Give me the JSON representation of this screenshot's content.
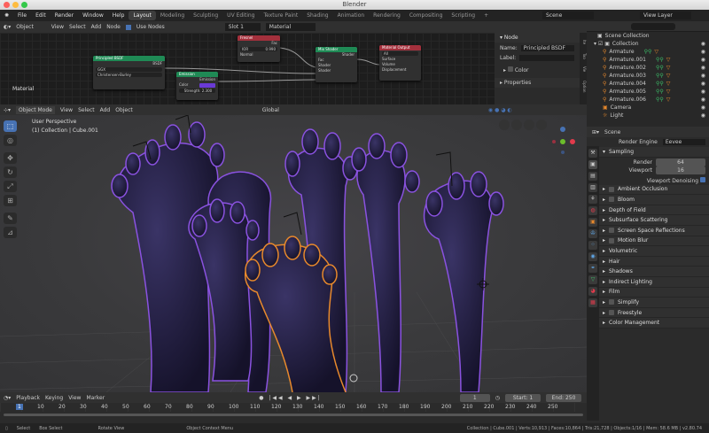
{
  "window": {
    "title": "Blender"
  },
  "topbar": {
    "menus": [
      "File",
      "Edit",
      "Render",
      "Window",
      "Help"
    ],
    "workspaces": [
      "Layout",
      "Modeling",
      "Sculpting",
      "UV Editing",
      "Texture Paint",
      "Shading",
      "Animation",
      "Rendering",
      "Compositing",
      "Scripting"
    ],
    "active_workspace": "Layout",
    "add": "+",
    "scene": "Scene",
    "view_layer": "View Layer"
  },
  "node_header": {
    "mode": "Object",
    "menus": [
      "View",
      "Select",
      "Add",
      "Node"
    ],
    "use_nodes": "Use Nodes",
    "slot": "Slot 1",
    "material": "Material",
    "label": "Material"
  },
  "nodes": {
    "principled": {
      "title": "Principled BSDF",
      "out": "BSDF",
      "dist": "GGX",
      "sss": "Christensen-Burley"
    },
    "fresnel": {
      "title": "Fresnel",
      "out": "Fac",
      "ior_label": "IOR",
      "ior": "0.990",
      "normal": "Normal"
    },
    "emission": {
      "title": "Emission",
      "out": "Emission",
      "color": "Color",
      "strength_label": "Strength",
      "strength": "2.300",
      "color_hex": "#6a3ad6"
    },
    "mix": {
      "title": "Mix Shader",
      "out": "Shader",
      "fac": "Fac",
      "s1": "Shader",
      "s2": "Shader"
    },
    "output": {
      "title": "Material Output",
      "target": "All",
      "surface": "Surface",
      "volume": "Volume",
      "disp": "Displacement"
    }
  },
  "node_sidebar": {
    "section": "Node",
    "name_label": "Name:",
    "name": "Principled BSDF",
    "label_label": "Label:",
    "color": "Color",
    "properties": "Properties",
    "tabs": [
      "Ite",
      "Too",
      "Vie",
      "Option"
    ]
  },
  "viewport": {
    "mode": "Object Mode",
    "menus": [
      "View",
      "Select",
      "Add",
      "Object"
    ],
    "orientation": "Global",
    "perspective": "User Perspective",
    "context": "(1) Collection | Cube.001"
  },
  "outliner": {
    "root": "Scene Collection",
    "collection": "Collection",
    "items": [
      "Armature",
      "Armature.001",
      "Armature.002",
      "Armature.003",
      "Armature.004",
      "Armature.005",
      "Armature.006",
      "Camera",
      "Light"
    ]
  },
  "properties": {
    "scene": "Scene",
    "engine_label": "Render Engine",
    "engine": "Eevee",
    "sampling": "Sampling",
    "render_label": "Render",
    "render": "64",
    "viewport_label": "Viewport",
    "viewport": "16",
    "denoise": "Viewport Denoising",
    "sections": [
      {
        "label": "Ambient Occlusion",
        "chk": true
      },
      {
        "label": "Bloom",
        "chk": true
      },
      {
        "label": "Depth of Field",
        "chk": false
      },
      {
        "label": "Subsurface Scattering",
        "chk": false
      },
      {
        "label": "Screen Space Reflections",
        "chk": true
      },
      {
        "label": "Motion Blur",
        "chk": true
      },
      {
        "label": "Volumetric",
        "chk": false
      },
      {
        "label": "Hair",
        "chk": false
      },
      {
        "label": "Shadows",
        "chk": false
      },
      {
        "label": "Indirect Lighting",
        "chk": false
      },
      {
        "label": "Film",
        "chk": false
      },
      {
        "label": "Simplify",
        "chk": true
      },
      {
        "label": "Freestyle",
        "chk": true
      },
      {
        "label": "Color Management",
        "chk": false
      }
    ]
  },
  "timeline": {
    "menus": [
      "Playback",
      "Keying",
      "View",
      "Marker"
    ],
    "current": "1",
    "start_label": "Start:",
    "start": "1",
    "end_label": "End:",
    "end": "250",
    "ticks": [
      "1",
      "10",
      "20",
      "30",
      "40",
      "50",
      "60",
      "70",
      "80",
      "90",
      "100",
      "110",
      "120",
      "130",
      "140",
      "150",
      "160",
      "170",
      "180",
      "190",
      "200",
      "210",
      "220",
      "230",
      "240",
      "250"
    ]
  },
  "status": {
    "select": "Select",
    "box": "Box Select",
    "rotate": "Rotate View",
    "context": "Object Context Menu",
    "stats": "Collection | Cube.001 | Verts:10,913 | Faces:10,864 | Tris:21,728 | Objects:1/16 | Mem: 58.6 MB | v2.80.74"
  }
}
